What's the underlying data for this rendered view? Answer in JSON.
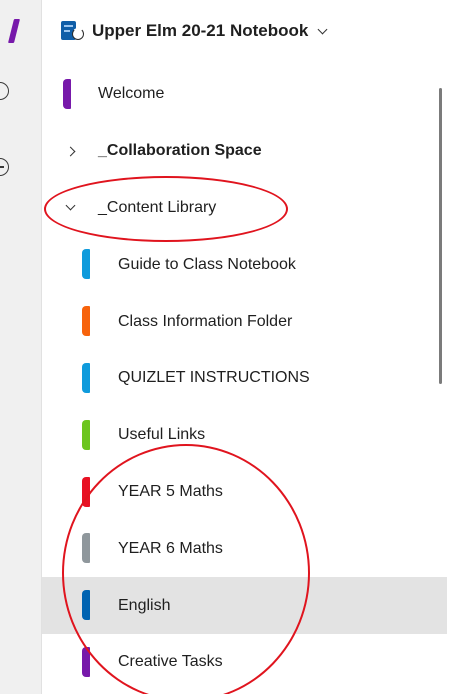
{
  "notebook": {
    "title": "Upper Elm 20-21 Notebook",
    "icon": "notebook-sync-icon"
  },
  "sections": [
    {
      "label": "Welcome",
      "kind": "section",
      "color": "#7719aa"
    },
    {
      "label": "_Collaboration Space",
      "kind": "group",
      "expanded": false
    },
    {
      "label": "_Content Library",
      "kind": "group",
      "expanded": true
    },
    {
      "label": "Guide to Class Notebook",
      "kind": "sub",
      "color": "#0f9bdc"
    },
    {
      "label": "Class Information Folder",
      "kind": "sub",
      "color": "#f7630c"
    },
    {
      "label": "QUIZLET INSTRUCTIONS",
      "kind": "sub",
      "color": "#0f9bdc"
    },
    {
      "label": "Useful Links",
      "kind": "sub",
      "color": "#6cc51f"
    },
    {
      "label": "YEAR 5 Maths",
      "kind": "sub",
      "color": "#e81123"
    },
    {
      "label": "YEAR 6 Maths",
      "kind": "sub",
      "color": "#8f979c"
    },
    {
      "label": "English",
      "kind": "sub",
      "color": "#0063b1",
      "selected": true
    },
    {
      "label": "Creative Tasks",
      "kind": "sub",
      "color": "#7719aa"
    }
  ],
  "colors": {
    "onenote_purple": "#7719aa",
    "selection_background": "#e3e3e3",
    "annotation_red": "#e0141e"
  }
}
